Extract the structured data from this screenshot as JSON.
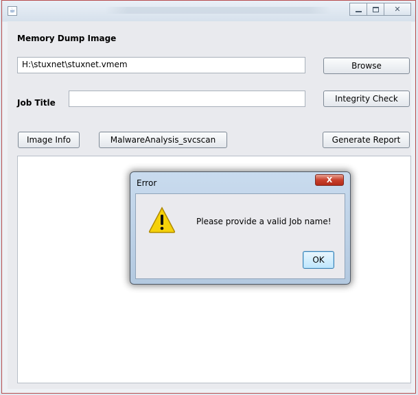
{
  "window": {
    "minimize_icon": "minimize-icon",
    "maximize_icon": "maximize-icon",
    "close_glyph": "✕"
  },
  "form": {
    "memory_dump_label": "Memory Dump Image",
    "memory_dump_path": "H:\\stuxnet\\stuxnet.vmem",
    "browse_label": "Browse",
    "job_title_label": "Job Title",
    "job_title_value": "",
    "integrity_check_label": "Integrity Check",
    "image_info_label": "Image Info",
    "malware_analysis_label": "MalwareAnalysis_svcscan",
    "generate_report_label": "Generate Report",
    "output_text": ""
  },
  "dialog": {
    "title": "Error",
    "close_glyph": "X",
    "message": "Please provide a valid Job name!",
    "ok_label": "OK",
    "icon": "warning-icon"
  },
  "colors": {
    "dialog_close": "#c9402c",
    "warning_yellow": "#f5d10a",
    "window_border": "#b64b4b"
  }
}
